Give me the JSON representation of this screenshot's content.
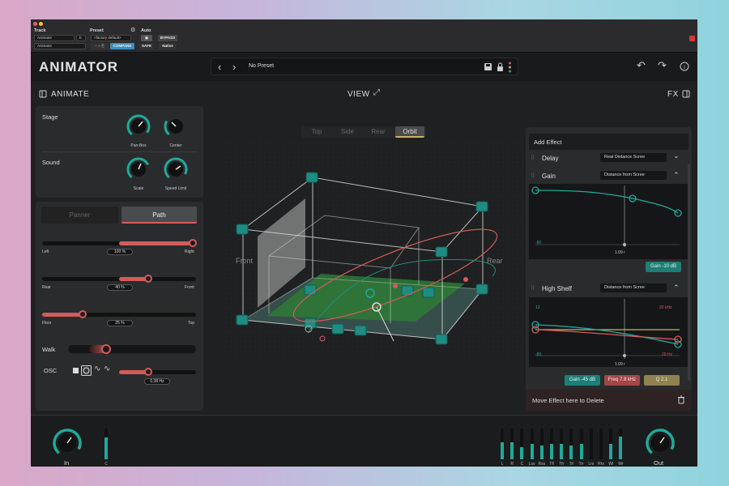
{
  "header": {
    "track_label": "Track",
    "preset_label": "Preset",
    "auto_label": "Auto",
    "track_value": "Animator",
    "track_b": "b",
    "preset_value": "<factory default>",
    "insert_value": "Animator",
    "compare_label": "COMPARE",
    "bypass_label": "BYPASS",
    "safe_label": "SAFE",
    "native_label": "Native"
  },
  "plugin": {
    "logo": "ANIMATOR",
    "preset_name": "No Preset",
    "animate_label": "ANIMATE",
    "view_label": "VIEW",
    "fx_label": "FX"
  },
  "view_tabs": [
    "Top",
    "Side",
    "Rear",
    "Orbit"
  ],
  "active_view": "Orbit",
  "scene_labels": {
    "front": "Front",
    "rear": "Rear"
  },
  "stage": {
    "stage_label": "Stage",
    "sound_label": "Sound",
    "knobs": [
      {
        "label": "Pan-Box"
      },
      {
        "label": "Center"
      },
      {
        "label": "Scale"
      },
      {
        "label": "Speed Limit"
      }
    ]
  },
  "mode_tabs": {
    "panner": "Panner",
    "path": "Path",
    "active": "Path"
  },
  "sliders": [
    {
      "left": "Left",
      "right": "Right",
      "value": "100 %",
      "fraction": 1.0
    },
    {
      "left": "Rear",
      "right": "Front",
      "value": "40 %",
      "fraction": 0.7
    },
    {
      "left": "Floor",
      "right": "Top",
      "value": "25 %",
      "fraction": 0.26
    }
  ],
  "walk": {
    "label": "Walk"
  },
  "osc": {
    "label": "OSC",
    "value": "0.38 Hz",
    "fraction": 0.18
  },
  "fx": {
    "add_effect": "Add Effect",
    "delay": {
      "title": "Delay",
      "source": "Real Distance Scree"
    },
    "gain": {
      "title": "Gain",
      "source": "Distance from Scree",
      "ylabel": "-80",
      "xlabel": "1.09 r",
      "badge": "Gain -10 dB"
    },
    "high_shelf": {
      "title": "High Shelf",
      "source": "Distance from Scree",
      "y_top_left": "12",
      "y_top_right": "20 kHz",
      "y_bottom_left": "-80",
      "y_bottom_right": "20 Hz",
      "xlabel": "1.09 r",
      "badges": [
        "Gain -45 dB",
        "Freq 7.8 kHz",
        "Q 2.1"
      ]
    },
    "drop_hint": "Move Effect here to Delete"
  },
  "io": {
    "in_label": "In",
    "in_channel": "C",
    "out_label": "Out",
    "channels": [
      "L",
      "R",
      "C",
      "Lss",
      "Rss",
      "Tfl",
      "Tfr",
      "Trl",
      "Trr",
      "Lrs",
      "Rrs",
      "Wl",
      "Wr"
    ],
    "channel_levels": [
      0.55,
      0.55,
      0.4,
      0.5,
      0.45,
      0.5,
      0.5,
      0.45,
      0.5,
      0.0,
      0.0,
      0.5,
      0.75
    ],
    "in_level": 0.7
  },
  "colors": {
    "accent": "#21a89b",
    "red": "#d35b5b",
    "gold": "#c9b46a"
  }
}
